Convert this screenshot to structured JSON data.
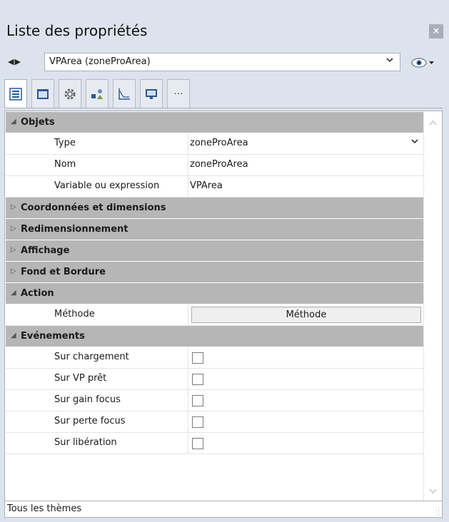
{
  "panel": {
    "title": "Liste des propriétés",
    "close_label": "×"
  },
  "nav": {
    "arrows": "◀▶"
  },
  "object_selector": {
    "value": "VPArea (zoneProArea)"
  },
  "toolbar": {
    "tabs": [
      {
        "icon": "list-icon",
        "active": true
      },
      {
        "icon": "window-icon",
        "active": false
      },
      {
        "icon": "gear-icon",
        "active": false
      },
      {
        "icon": "shapes-icon",
        "active": false
      },
      {
        "icon": "chart-icon",
        "active": false
      },
      {
        "icon": "monitor-icon",
        "active": false
      },
      {
        "icon": "more-icon",
        "active": false,
        "label": "···"
      }
    ]
  },
  "sections": {
    "objets": {
      "label": "Objets",
      "rows": {
        "type": {
          "name": "Type",
          "value": "zoneProArea"
        },
        "nom": {
          "name": "Nom",
          "value": "zoneProArea"
        },
        "variable": {
          "name": "Variable ou expression",
          "value": "VPArea"
        }
      }
    },
    "coordonnees": {
      "label": "Coordonnées et dimensions"
    },
    "redimensionnement": {
      "label": "Redimensionnement"
    },
    "affichage": {
      "label": "Affichage"
    },
    "fond": {
      "label": "Fond et Bordure"
    },
    "action": {
      "label": "Action",
      "rows": {
        "methode": {
          "name": "Méthode",
          "button_label": "Méthode"
        }
      }
    },
    "evenements": {
      "label": "Evénements",
      "rows": {
        "chargement": {
          "name": "Sur chargement",
          "checked": false
        },
        "vp_pret": {
          "name": "Sur VP prêt",
          "checked": false
        },
        "gain_focus": {
          "name": "Sur gain focus",
          "checked": false
        },
        "perte_focus": {
          "name": "Sur perte focus",
          "checked": false
        },
        "liberation": {
          "name": "Sur libération",
          "checked": false
        }
      }
    }
  },
  "status_bar": {
    "text": "Tous les thèmes"
  },
  "colors": {
    "section_bg": "#b6b6b6",
    "panel_bg": "#dde3ec",
    "accent_blue": "#2b5797"
  }
}
